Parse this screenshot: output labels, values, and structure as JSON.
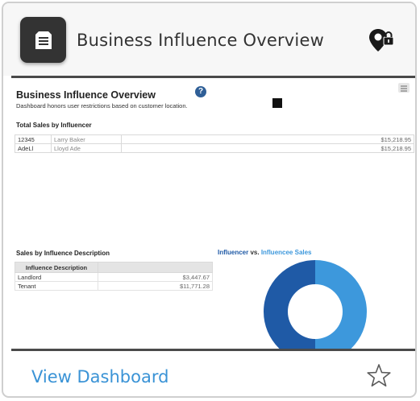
{
  "card": {
    "title": "Business Influence Overview",
    "view_link": "View Dashboard",
    "icons": {
      "app": "document-icon",
      "restriction": "location-lock-icon",
      "favorite": "star-icon"
    }
  },
  "preview": {
    "title": "Business Influence Overview",
    "subtitle": "Dashboard honors user restrictions based on customer location.",
    "help_glyph": "?",
    "total_sales": {
      "title": "Total Sales by Influencer",
      "rows": [
        {
          "id": "12345",
          "name": "Larry Baker",
          "amount": "$15,218.95"
        },
        {
          "id": "AdeLl",
          "name": "Lloyd Ade",
          "amount": "$15,218.95"
        }
      ]
    },
    "by_description": {
      "title": "Sales by Influence Description",
      "header": "Influence Description",
      "rows": [
        {
          "label": "Landlord",
          "amount": "$3,447.67"
        },
        {
          "label": "Tenant",
          "amount": "$11,771.28"
        }
      ]
    },
    "donut": {
      "title_a": "Influencer",
      "title_vs": " vs. ",
      "title_b": "Influencee Sales",
      "colors": {
        "influencer": "#1f5aa6",
        "influencee": "#3d98dc"
      }
    }
  }
}
